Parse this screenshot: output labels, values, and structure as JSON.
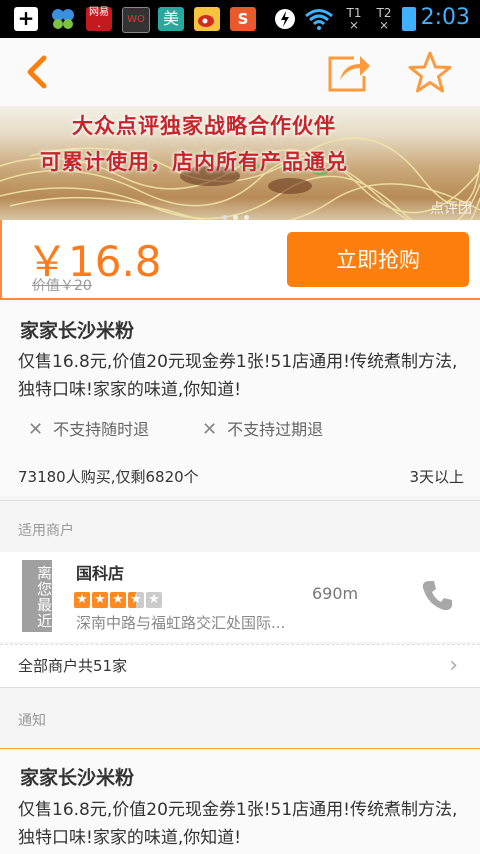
{
  "status_bar": {
    "icons": [
      "plus-icon",
      "butterfly-icon",
      "netease-icon",
      "wo-icon",
      "mei-icon",
      "weibo-icon",
      "s-app-icon",
      "bolt-icon",
      "wifi-icon",
      "sim1-icon",
      "sim2-icon",
      "battery-icon"
    ],
    "mei_label": "美",
    "sim1": "1",
    "sim2": "2",
    "time": "2:03"
  },
  "banner": {
    "line1": "大众点评独家战略合作伙伴",
    "line2": "可累计使用，店内所有产品通兑",
    "logo": "点评团"
  },
  "price": {
    "current": "￥16.8",
    "original": "价值￥20",
    "buy_label": "立即抢购"
  },
  "deal": {
    "title": "家家长沙米粉",
    "description": "仅售16.8元,价值20元现金券1张!51店通用!传统煮制方法,独特口味!家家的味道,你知道!",
    "policy1": "不支持随时退",
    "policy2": "不支持过期退",
    "sales": "73180人购买,仅剩6820个",
    "days_left": "3天以上"
  },
  "merchants": {
    "section_label": "适用商户",
    "nearest_badge": "离您最近",
    "name": "国科店",
    "rating": 3.5,
    "distance": "690m",
    "address": "深南中路与福虹路交汇处国际...",
    "all_label": "全部商户共51家"
  },
  "notice": {
    "section_label": "通知",
    "title": "家家长沙米粉",
    "description": "仅售16.8元,价值20元现金券1张!51店通用!传统煮制方法,独特口味!家家的味道,你知道!"
  },
  "colors": {
    "accent": "#ff7f0e",
    "price": "#ff7a1a",
    "time": "#3fb1ff"
  }
}
